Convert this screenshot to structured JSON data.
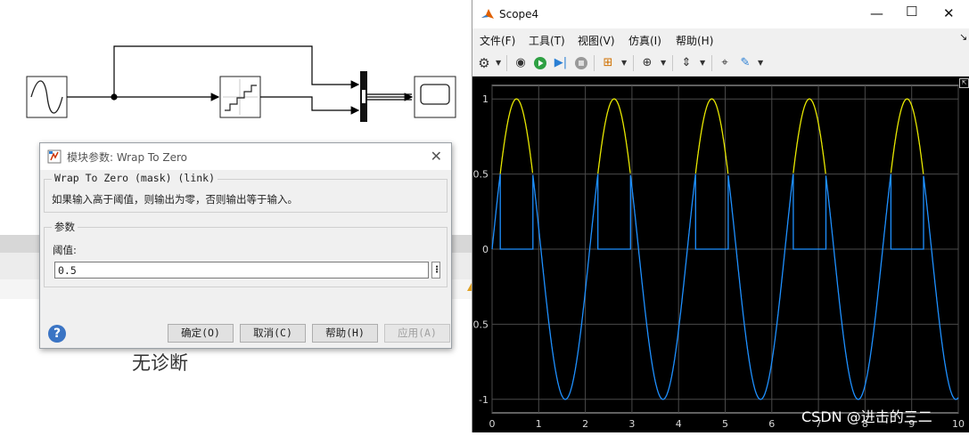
{
  "dialog": {
    "title": "模块参数: Wrap To Zero",
    "mask_header": "Wrap To Zero (mask) (link)",
    "description": "如果输入高于阈值，则输出为零，否则输出等于输入。",
    "params_group": "参数",
    "threshold_label": "阈值:",
    "threshold_value": "0.5",
    "buttons": {
      "ok": "确定(O)",
      "cancel": "取消(C)",
      "help": "帮助(H)",
      "apply": "应用(A)"
    }
  },
  "canvas": {
    "diagnostics_text": "无诊断"
  },
  "scope": {
    "title": "Scope4",
    "menu": [
      "文件(F)",
      "工具(T)",
      "视图(V)",
      "仿真(I)",
      "帮助(H)"
    ],
    "toolbar_icons": [
      "settings-icon",
      "restore-icon",
      "run-icon",
      "step-forward-icon",
      "stop-icon",
      "highlight-block-icon",
      "zoom-icon",
      "scale-axes-icon",
      "cursor-measure-icon",
      "style-icon"
    ]
  },
  "watermark": "CSDN @进击的三二",
  "chart_data": {
    "type": "line",
    "xlim": [
      0,
      10
    ],
    "ylim": [
      -1,
      1
    ],
    "x_ticks": [
      "0",
      "1",
      "2",
      "3",
      "4",
      "5",
      "6",
      "7",
      "8",
      "9",
      "10"
    ],
    "y_ticks": [
      "1",
      "0.5",
      "0",
      "-0.5",
      "-1"
    ],
    "grid": true,
    "series": [
      {
        "color": "#e8e800",
        "kind": "wrapped_part",
        "function": "sin(3t) where sin(3t) > 0.5"
      },
      {
        "color": "#1e90ff",
        "kind": "wrap_to_zero_output",
        "function": "sin(3t) if sin(3t) <= 0.5 else 0",
        "threshold": 0.5,
        "frequency_rad_s": 3
      }
    ],
    "colors": {
      "background": "#000000",
      "grid": "#4a4a4a",
      "axes": "#bfbfbf"
    }
  }
}
